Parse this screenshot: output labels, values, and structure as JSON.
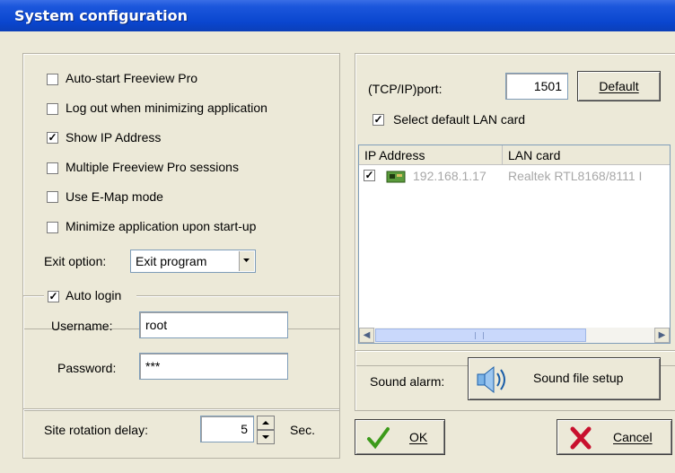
{
  "window": {
    "title": "System configuration"
  },
  "options": {
    "auto_start": {
      "label": "Auto-start Freeview Pro",
      "checked": false
    },
    "logout_minimize": {
      "label": "Log out when minimizing application",
      "checked": false
    },
    "show_ip": {
      "label": "Show IP Address",
      "checked": true
    },
    "multiple_sessions": {
      "label": "Multiple Freeview Pro sessions",
      "checked": false
    },
    "emap_mode": {
      "label": "Use E-Map mode",
      "checked": false
    },
    "minimize_startup": {
      "label": "Minimize application upon start-up",
      "checked": false
    },
    "exit_option": {
      "label": "Exit option:",
      "value": "Exit program"
    }
  },
  "auto_login": {
    "label": "Auto login",
    "checked": true,
    "username_label": "Username:",
    "username_value": "root",
    "password_label": "Password:",
    "password_value": "***"
  },
  "site_rotation": {
    "label": "Site rotation delay:",
    "value": "5",
    "unit": "Sec."
  },
  "network": {
    "port_label": "(TCP/IP)port:",
    "port_value": "1501",
    "default_button": "Default",
    "default_lan": {
      "label": "Select default LAN card",
      "checked": true
    },
    "columns": [
      "IP Address",
      "LAN card"
    ],
    "rows": [
      {
        "checked": true,
        "ip": "192.168.1.17",
        "lan": "Realtek RTL8168/8111 I"
      }
    ]
  },
  "sound": {
    "label": "Sound alarm:",
    "button": "Sound file setup",
    "icon": "speaker-icon"
  },
  "buttons": {
    "ok": "OK",
    "cancel": "Cancel"
  },
  "colors": {
    "title_bar": "#0a46cf",
    "dialog_bg": "#ece9d8",
    "ok_icon": "#3c9a1a",
    "cancel_icon": "#c8102e"
  }
}
